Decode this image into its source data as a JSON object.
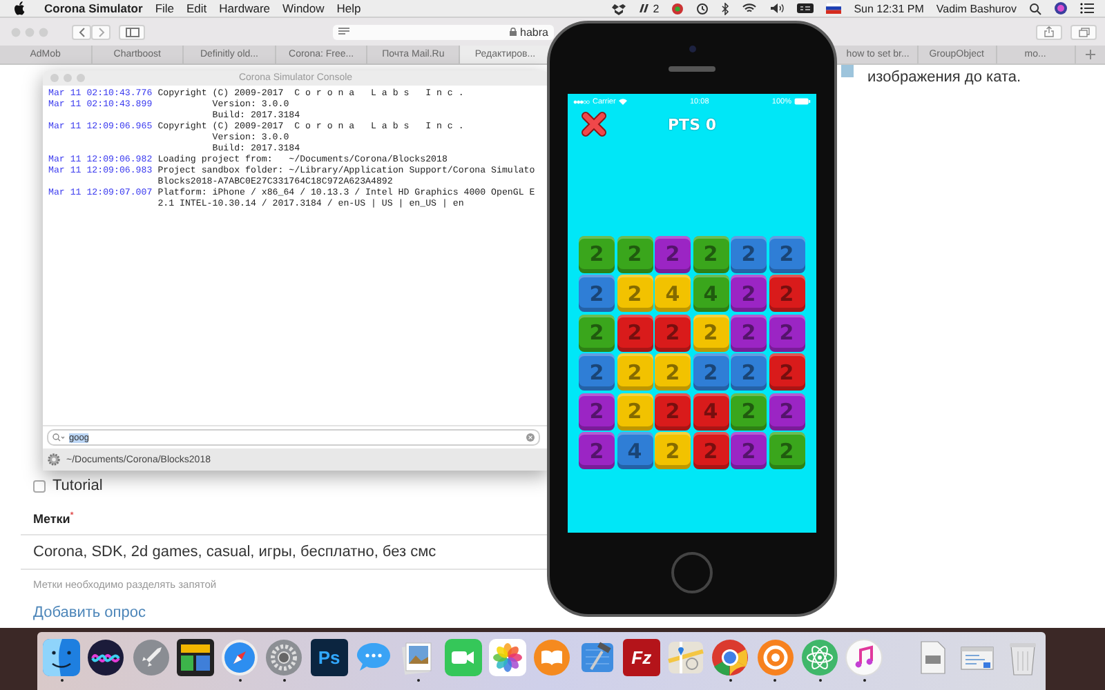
{
  "menu_bar": {
    "app_name": "Corona Simulator",
    "menus": [
      "File",
      "Edit",
      "Hardware",
      "Window",
      "Help"
    ],
    "status_items": [
      {
        "kind": "box"
      },
      {
        "kind": "bars",
        "count": "2"
      },
      {
        "kind": "disc"
      },
      {
        "kind": "history"
      },
      {
        "kind": "bluetooth"
      },
      {
        "kind": "wifi"
      },
      {
        "kind": "volume"
      },
      {
        "kind": "keyboard"
      },
      {
        "kind": "flag"
      }
    ],
    "clock": "Sun 12:31 PM",
    "user": "Vadim Bashurov"
  },
  "browser": {
    "address": "habra",
    "tabs": [
      {
        "label": "AdMob",
        "selected": false
      },
      {
        "label": "Chartboost",
        "selected": false
      },
      {
        "label": "Definitly old...",
        "selected": false
      },
      {
        "label": "Corona: Free...",
        "selected": false
      },
      {
        "label": "Почта Mail.Ru",
        "selected": false
      },
      {
        "label": "Редактиров...",
        "selected": true
      }
    ],
    "tabs_right": [
      {
        "label": "how to set br...",
        "selected": false
      },
      {
        "label": "GroupObject",
        "selected": false
      },
      {
        "label": "mo...",
        "selected": false
      }
    ],
    "page": {
      "fragment_text": "изображения до ката.",
      "tutorial": {
        "label": "Tutorial",
        "checked": false
      },
      "tags_label": "Метки$^{*}$",
      "tags_value": "Corona, SDK, 2d games, casual, игры, бесплатно, без смс",
      "tags_hint": "Метки необходимо разделять запятой",
      "add_poll_link": "Добавить опрос"
    }
  },
  "console": {
    "title": "Corona Simulator Console",
    "entries": [
      {
        "time": "Mar 11 02:10:43.776",
        "lines": [
          {
            "kind": "plain",
            "text": "Copyright (C) 2009-2017  C o r o n a   L a b s   I n c ."
          }
        ]
      },
      {
        "time": "Mar 11 02:10:43.899",
        "lines": [
          {
            "kind": "indented",
            "text": "Version: 3.0.0"
          },
          {
            "kind": "indented",
            "text": "Build: 2017.3184"
          }
        ]
      },
      {
        "time": "Mar 11 12:09:06.965",
        "lines": [
          {
            "kind": "plain",
            "text": "Copyright (C) 2009-2017  C o r o n a   L a b s   I n c ."
          },
          {
            "kind": "indented",
            "text": "Version: 3.0.0"
          },
          {
            "kind": "indented",
            "text": "Build: 2017.3184"
          }
        ]
      },
      {
        "time": "Mar 11 12:09:06.982",
        "lines": [
          {
            "kind": "plain",
            "text": "Loading project from:   ~/Documents/Corona/Blocks2018"
          }
        ]
      },
      {
        "time": "Mar 11 12:09:06.983",
        "lines": [
          {
            "kind": "plain",
            "text": "Project sandbox folder: ~/Library/Application Support/Corona Simulato"
          },
          {
            "kind": "plain",
            "text": "Blocks2018-A7ABC0E27C331764C18C972A623A4892"
          }
        ]
      },
      {
        "time": "Mar 11 12:09:07.007",
        "lines": [
          {
            "kind": "plain",
            "text": "Platform: iPhone / x86_64 / 10.13.3 / Intel HD Graphics 4000 OpenGL E"
          },
          {
            "kind": "plain",
            "text": "2.1 INTEL-10.30.14 / 2017.3184 / en-US | US | en_US | en"
          }
        ]
      }
    ],
    "search": {
      "value": "goog"
    },
    "path": "~/Documents/Corona/Blocks2018"
  },
  "simulator": {
    "carrier": "Carrier",
    "time": "10:08",
    "battery": "100%",
    "score": "PTS 0",
    "grid": [
      [
        {
          "color": "#3aa61c",
          "value": "2"
        },
        {
          "color": "#3aa61c",
          "value": "2"
        },
        {
          "color": "#9b25c4",
          "value": "2"
        },
        {
          "color": "#3aa61c",
          "value": "2"
        },
        {
          "color": "#2f7ed6",
          "value": "2"
        },
        {
          "color": "#2f7ed6",
          "value": "2"
        }
      ],
      [
        {
          "color": "#2f7ed6",
          "value": "2"
        },
        {
          "color": "#f2c200",
          "value": "2"
        },
        {
          "color": "#f2c200",
          "value": "4"
        },
        {
          "color": "#3aa61c",
          "value": "4"
        },
        {
          "color": "#9b25c4",
          "value": "2"
        },
        {
          "color": "#d91b1b",
          "value": "2"
        }
      ],
      [
        {
          "color": "#3aa61c",
          "value": "2"
        },
        {
          "color": "#d91b1b",
          "value": "2"
        },
        {
          "color": "#d91b1b",
          "value": "2"
        },
        {
          "color": "#f2c200",
          "value": "2"
        },
        {
          "color": "#9b25c4",
          "value": "2"
        },
        {
          "color": "#9b25c4",
          "value": "2"
        }
      ],
      [
        {
          "color": "#2f7ed6",
          "value": "2"
        },
        {
          "color": "#f2c200",
          "value": "2"
        },
        {
          "color": "#f2c200",
          "value": "2"
        },
        {
          "color": "#2f7ed6",
          "value": "2"
        },
        {
          "color": "#2f7ed6",
          "value": "2"
        },
        {
          "color": "#d91b1b",
          "value": "2"
        }
      ],
      [
        {
          "color": "#9b25c4",
          "value": "2"
        },
        {
          "color": "#f2c200",
          "value": "2"
        },
        {
          "color": "#d91b1b",
          "value": "2"
        },
        {
          "color": "#d91b1b",
          "value": "4"
        },
        {
          "color": "#3aa61c",
          "value": "2"
        },
        {
          "color": "#9b25c4",
          "value": "2"
        }
      ],
      [
        {
          "color": "#9b25c4",
          "value": "2"
        },
        {
          "color": "#2f7ed6",
          "value": "4"
        },
        {
          "color": "#f2c200",
          "value": "2"
        },
        {
          "color": "#d91b1b",
          "value": "2"
        },
        {
          "color": "#9b25c4",
          "value": "2"
        },
        {
          "color": "#3aa61c",
          "value": "2"
        }
      ]
    ]
  },
  "dock": {
    "items": [
      {
        "kind": "finder",
        "running": true
      },
      {
        "kind": "siri",
        "running": false
      },
      {
        "kind": "launchpad",
        "running": false
      },
      {
        "kind": "monitor",
        "running": false
      },
      {
        "kind": "safari",
        "running": true
      },
      {
        "kind": "settings",
        "running": true
      },
      {
        "kind": "tile",
        "label": "Ps",
        "running": false
      },
      {
        "kind": "messages",
        "running": false
      },
      {
        "kind": "preview",
        "running": true
      },
      {
        "kind": "facetime",
        "running": false
      },
      {
        "kind": "photos",
        "running": false
      },
      {
        "kind": "books",
        "running": false
      },
      {
        "kind": "xcode",
        "running": false
      },
      {
        "kind": "tile_red",
        "label": "Fz",
        "running": false
      },
      {
        "kind": "maps",
        "running": false
      },
      {
        "kind": "chrome",
        "running": true
      },
      {
        "kind": "corona",
        "running": true
      },
      {
        "kind": "atom",
        "running": true
      },
      {
        "kind": "itunes",
        "running": true
      },
      {
        "kind": "document",
        "running": false
      },
      {
        "kind": "window",
        "running": false
      },
      {
        "kind": "trash",
        "running": false
      }
    ]
  }
}
